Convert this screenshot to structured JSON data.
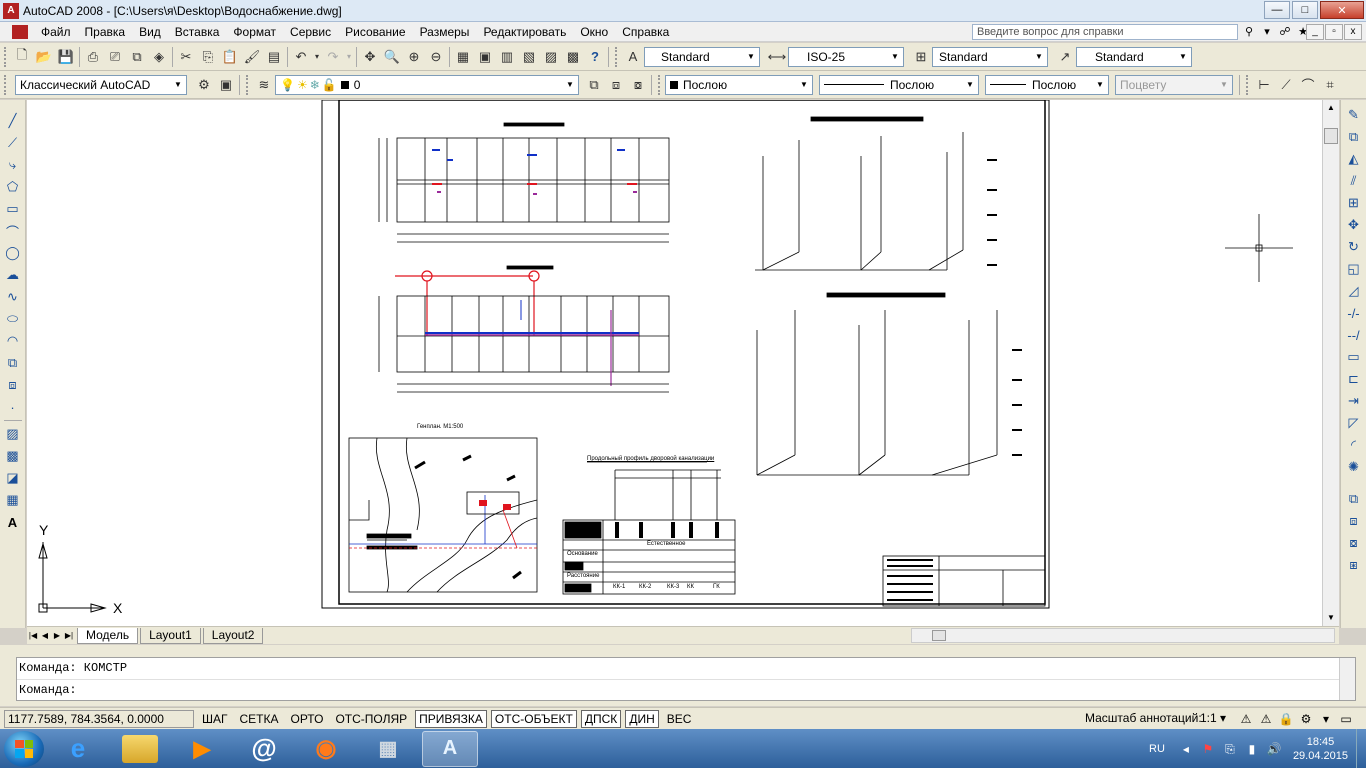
{
  "window": {
    "title": "AutoCAD 2008 - [C:\\Users\\я\\Desktop\\Водоснабжение.dwg]",
    "logo_text": "A",
    "minimize": "—",
    "maximize": "□",
    "close": "✕"
  },
  "menu": {
    "items": [
      "Файл",
      "Правка",
      "Вид",
      "Вставка",
      "Формат",
      "Сервис",
      "Рисование",
      "Размеры",
      "Редактировать",
      "Окно",
      "Справка"
    ],
    "help_placeholder": "Введите вопрос для справки",
    "mdi_min": "_",
    "mdi_restore": "▫",
    "mdi_close": "x"
  },
  "toolbar1": {
    "text_style": "Standard",
    "dim_style": "ISO-25",
    "table_style": "Standard",
    "mleader_style": "Standard"
  },
  "toolbar2": {
    "workspace": "Классический AutoCAD",
    "layer": "0",
    "color": "Послою",
    "linetype": "Послою",
    "lineweight": "Послою",
    "plotstyle": "Поцвету"
  },
  "drawing": {
    "genplan_title": "Генплан. М1:500",
    "profile_title": "Продольный профиль дворовой канализации",
    "ucs_y": "Y",
    "ucs_x": "X",
    "profile_row1": "Основание",
    "profile_row2": "Расстояние",
    "profile_row3": "Естественное",
    "profile_wells": [
      "КК-1",
      "КК-2",
      "КК-3",
      "КК",
      "ГК"
    ]
  },
  "tabs": {
    "model": "Модель",
    "layout1": "Layout1",
    "layout2": "Layout2"
  },
  "command": {
    "line1": "Команда: КОМСТР",
    "line2": "Команда:"
  },
  "status": {
    "coords": "1177.7589, 784.3564, 0.0000",
    "buttons": [
      {
        "label": "ШАГ",
        "on": false
      },
      {
        "label": "СЕТКА",
        "on": false
      },
      {
        "label": "ОРТО",
        "on": false
      },
      {
        "label": "ОТС-ПОЛЯР",
        "on": false
      },
      {
        "label": "ПРИВЯЗКА",
        "on": true
      },
      {
        "label": "ОТС-ОБЪЕКТ",
        "on": true
      },
      {
        "label": "ДПСК",
        "on": true
      },
      {
        "label": "ДИН",
        "on": true
      },
      {
        "label": "ВЕС",
        "on": false
      }
    ],
    "annotation_label": "Масштаб аннотаций:",
    "annotation_scale": "1:1"
  },
  "taskbar": {
    "autocad_icon": "A",
    "lang": "RU",
    "time": "18:45",
    "date": "29.04.2015"
  },
  "colors": {
    "drawing_red": "#e0141e",
    "drawing_blue": "#1030c8",
    "drawing_magenta": "#9a2a9a"
  }
}
